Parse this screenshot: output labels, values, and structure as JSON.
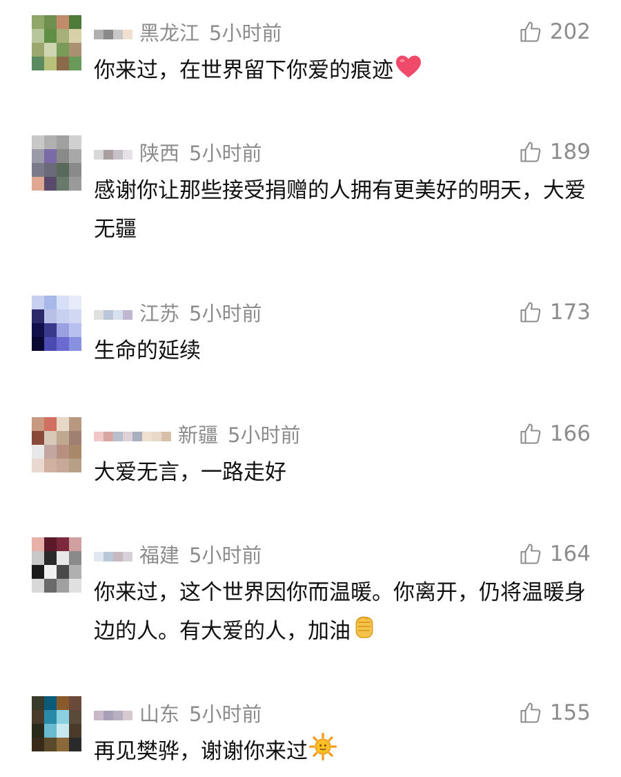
{
  "comments": [
    {
      "region": "黑龙江",
      "time": "5小时前",
      "likes": "202",
      "text": "你来过，在世界留下你爱的痕迹",
      "emoji": "heart-emoji",
      "avatar_colors": [
        "#8fa86a",
        "#6e8f4e",
        "#c28b6a",
        "#4f7a3a",
        "#b7c79b",
        "#5e8f44",
        "#a8b07a",
        "#d8d0a8",
        "#9aa870",
        "#cdd6b0",
        "#7a9a5a",
        "#a89070",
        "#5a8a60",
        "#b8c07a",
        "#8a6a4a",
        "#6a9a5a"
      ],
      "name_blur": [
        "#b0b0b0",
        "#8a8a8a",
        "#c8c8c8",
        "#f0e0d0"
      ]
    },
    {
      "region": "陕西",
      "time": "5小时前",
      "likes": "189",
      "text": "感谢你让那些接受捐赠的人拥有更美好的明天，大爱无疆",
      "emoji": "",
      "avatar_colors": [
        "#c8c8c8",
        "#b0b0b0",
        "#a0a0a0",
        "#d0d0d0",
        "#9a9aa8",
        "#7a6aa8",
        "#8a8a8a",
        "#a8a8a8",
        "#7a7a8a",
        "#6a6a7a",
        "#5a6a5a",
        "#8a8a8a",
        "#e0a890",
        "#5a4a6a",
        "#6a7a6a",
        "#9a9a9a"
      ],
      "name_blur": [
        "#d8d8d8",
        "#a8a0a0",
        "#c8c0c8",
        "#e8e0e8"
      ]
    },
    {
      "region": "江苏",
      "time": "5小时前",
      "likes": "173",
      "text": "生命的延续",
      "emoji": "",
      "avatar_colors": [
        "#c8d0f0",
        "#a8b8e8",
        "#d8e0f8",
        "#e8ecfa",
        "#2a2a6a",
        "#b8c0e8",
        "#c8d0f0",
        "#d0d8f4",
        "#10104a",
        "#3a3a8a",
        "#9aa0e0",
        "#b8c0f0",
        "#080830",
        "#4a4ab0",
        "#6a6ad0",
        "#8a90e0"
      ],
      "name_blur": [
        "#e0e0e0",
        "#b8c8d8",
        "#d8e0f0",
        "#c0b8d0"
      ]
    },
    {
      "region": "新疆",
      "time": "5小时前",
      "likes": "166",
      "text": "大爱无言，一路走好",
      "emoji": "",
      "avatar_colors": [
        "#c89880",
        "#d07060",
        "#e8d8c8",
        "#b89880",
        "#8a4a3a",
        "#d8c8b8",
        "#c0a890",
        "#a08070",
        "#e8e8e8",
        "#c0a8a0",
        "#b89080",
        "#a88868",
        "#e8d8d0",
        "#d0b0a0",
        "#c8a898",
        "#b8a088"
      ],
      "name_blur": [
        "#f0c8c8",
        "#d8a8a0",
        "#b8c0d0",
        "#e0d0d8",
        "#a8b0c0",
        "#f0e0d0",
        "#e8d8c8",
        "#d8c0a8"
      ]
    },
    {
      "region": "福建",
      "time": "5小时前",
      "likes": "164",
      "text": "你来过，这个世界因你而温暖。你离开，仍将温暖身边的人。有大爱的人，加油",
      "emoji": "fist-emoji",
      "avatar_colors": [
        "#e8b0a8",
        "#5a1a2a",
        "#7a2a3a",
        "#d0a0a0",
        "#c8c8c8",
        "#2a2a2a",
        "#e8e8e8",
        "#8a8a8a",
        "#1a1a1a",
        "#f0f0f0",
        "#4a4a4a",
        "#b0b0b0",
        "#d8d8d8",
        "#6a6a6a",
        "#a0a0a0",
        "#e0e0e0"
      ],
      "name_blur": [
        "#e0e8f0",
        "#b8c8d8",
        "#c8b8c0",
        "#d8d0d8"
      ]
    },
    {
      "region": "山东",
      "time": "5小时前",
      "likes": "155",
      "text": "再见樊骅，谢谢你来过",
      "emoji": "sun-emoji",
      "avatar_colors": [
        "#3a3a2a",
        "#0a5a7a",
        "#8a5a2a",
        "#6a4a3a",
        "#4a3a2a",
        "#2a8aaa",
        "#8ad0e0",
        "#5a4a3a",
        "#2a2a1a",
        "#6abad0",
        "#c8e8f0",
        "#4a3a2a",
        "#3a2a1a",
        "#5a4a2a",
        "#8a6a3a",
        "#2a2a2a"
      ],
      "name_blur": [
        "#c8b8c8",
        "#a8a0b8",
        "#b8b0c0",
        "#d8c8d0"
      ]
    }
  ]
}
